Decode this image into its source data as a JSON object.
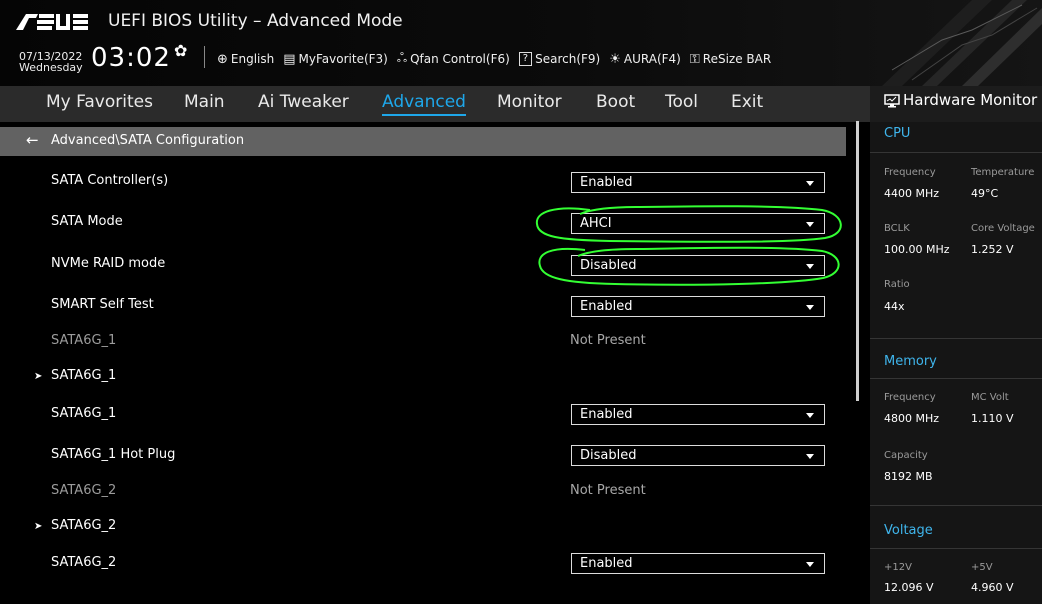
{
  "header": {
    "title": "UEFI BIOS Utility – Advanced Mode",
    "date": "07/13/2022",
    "weekday": "Wednesday",
    "time": "03:02",
    "settings_icon": "gear-icon",
    "toolbar": [
      {
        "icon": "globe-icon",
        "label": "English"
      },
      {
        "icon": "favorite-icon",
        "label": "MyFavorite(F3)"
      },
      {
        "icon": "fan-icon",
        "label": "Qfan Control(F6)"
      },
      {
        "icon": "search-icon",
        "label": "Search(F9)"
      },
      {
        "icon": "aura-icon",
        "label": "AURA(F4)"
      },
      {
        "icon": "resize-bar-icon",
        "label": "ReSize BAR"
      }
    ],
    "search_box_glyph": "?"
  },
  "nav": {
    "tabs": [
      "My Favorites",
      "Main",
      "Ai Tweaker",
      "Advanced",
      "Monitor",
      "Boot",
      "Tool",
      "Exit"
    ],
    "active": "Advanced"
  },
  "breadcrumb": "Advanced\\SATA Configuration",
  "settings": [
    {
      "label": "SATA Controller(s)",
      "value": "Enabled",
      "type": "select"
    },
    {
      "label": "SATA Mode",
      "value": "AHCI",
      "type": "select"
    },
    {
      "label": "NVMe RAID mode",
      "value": "Disabled",
      "type": "select"
    },
    {
      "label": "SMART Self Test",
      "value": "Enabled",
      "type": "select"
    },
    {
      "label": "SATA6G_1",
      "value": "Not Present",
      "type": "info"
    },
    {
      "label": "SATA6G_1",
      "value": "",
      "type": "submenu"
    },
    {
      "label": "SATA6G_1",
      "value": "Enabled",
      "type": "select"
    },
    {
      "label": "SATA6G_1 Hot Plug",
      "value": "Disabled",
      "type": "select"
    },
    {
      "label": "SATA6G_2",
      "value": "Not Present",
      "type": "info"
    },
    {
      "label": "SATA6G_2",
      "value": "",
      "type": "submenu"
    },
    {
      "label": "SATA6G_2",
      "value": "Enabled",
      "type": "select"
    }
  ],
  "hardware_monitor": {
    "title": "Hardware Monitor",
    "cpu": {
      "heading": "CPU",
      "frequency_label": "Frequency",
      "frequency": "4400 MHz",
      "temperature_label": "Temperature",
      "temperature": "49°C",
      "bclk_label": "BCLK",
      "bclk": "100.00 MHz",
      "core_voltage_label": "Core Voltage",
      "core_voltage": "1.252 V",
      "ratio_label": "Ratio",
      "ratio": "44x"
    },
    "memory": {
      "heading": "Memory",
      "frequency_label": "Frequency",
      "frequency": "4800 MHz",
      "mc_volt_label": "MC Volt",
      "mc_volt": "1.110 V",
      "capacity_label": "Capacity",
      "capacity": "8192 MB"
    },
    "voltage": {
      "heading": "Voltage",
      "v12_label": "+12V",
      "v12": "12.096 V",
      "v5_label": "+5V",
      "v5": "4.960 V"
    }
  },
  "colors": {
    "accent": "#1ea7ea",
    "annotation": "#33ff33",
    "breadcrumb_bg": "#626262"
  }
}
